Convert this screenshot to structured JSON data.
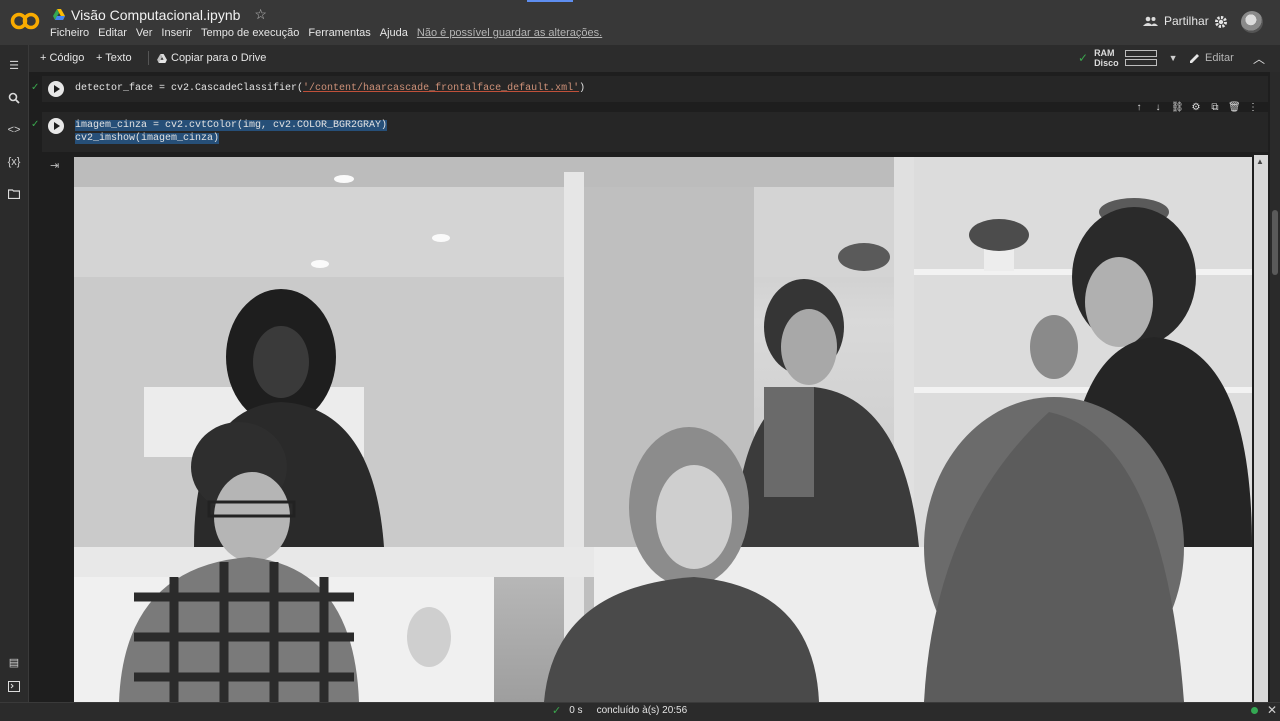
{
  "header": {
    "logo_text": "CO",
    "doc_title": "Visão Computacional.ipynb",
    "star_icon": "star-outline-icon",
    "menu": [
      "Ficheiro",
      "Editar",
      "Ver",
      "Inserir",
      "Tempo de execução",
      "Ferramentas",
      "Ajuda"
    ],
    "warning": "Não é possível guardar as alterações.",
    "share_label": "Partilhar"
  },
  "toolbar": {
    "add_code": "+ Código",
    "add_text": "+ Texto",
    "copy_drive": "Copiar para o Drive",
    "ram_label": "RAM",
    "disk_label": "Disco",
    "edit_label": "Editar"
  },
  "cells": {
    "cell1": {
      "code_prefix": "detector_face = cv2.CascadeClassifier(",
      "code_string": "'/content/haarcascade_frontalface_default.xml'",
      "code_suffix": ")"
    },
    "cell2": {
      "line1": "imagem_cinza = cv2.cvtColor(img, cv2.COLOR_BGR2GRAY)",
      "line2": "cv2_imshow(imagem_cinza)"
    }
  },
  "status": {
    "check": "✓",
    "duration": "0 s",
    "message": "concluído à(s) 20:56"
  },
  "colors": {
    "accent_logo": "#f9ab00",
    "selection": "#264f78",
    "success": "#34a853"
  }
}
